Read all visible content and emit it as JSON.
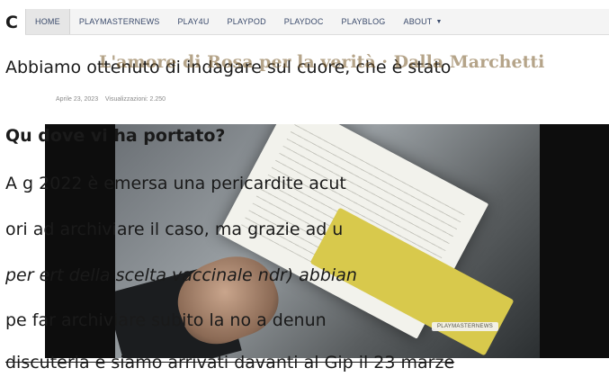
{
  "nav": {
    "items": [
      "HOME",
      "PLAYMASTERNEWS",
      "PLAY4U",
      "PLAYPOD",
      "PLAYDOC",
      "PLAYBLOG",
      "ABOUT"
    ],
    "active": "HOME"
  },
  "article_overlay": {
    "title": "L'amore di Rosa per la verità · Dalla Marchetti",
    "date": "Aprile 23, 2023",
    "views": "Visualizzazioni: 2.250",
    "photo_badge": "PLAYMASTERNEWS"
  },
  "bg": {
    "heading_c": "C",
    "line1": "Abbiamo ottenuto di indagare sul cuore, che è stato",
    "question": "Qu       dove vi ha portato?",
    "p1": "A g       2022 è emersa una pericardite acut",
    "p2": "ori         ad archiviare il caso, ma grazie ad u",
    "p3": "per         ert        della scelta vaccinale ndr) abbian",
    "p4": "pe          far archiviare subito la no     a denun",
    "p5": "discuterla e siamo arrivati davanti al Gip il 23 marze"
  }
}
